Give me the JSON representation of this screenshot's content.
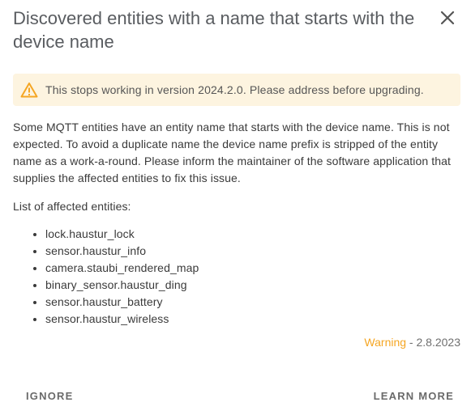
{
  "dialog": {
    "title": "Discovered entities with a name that starts with the device name",
    "close_icon": "close-icon"
  },
  "alert": {
    "icon": "warning-triangle-icon",
    "text": "This stops working in version 2024.2.0. Please address before upgrading.",
    "icon_color": "#f5a623",
    "background": "#fdf4e0"
  },
  "body": {
    "description": "Some MQTT entities have an entity name that starts with the device name. This is not expected. To avoid a duplicate name the device name prefix is stripped of the entity name as a work-a-round. Please inform the maintainer of the software application that supplies the affected entities to fix this issue.",
    "list_heading": "List of affected entities:",
    "entities": [
      "lock.haustur_lock",
      "sensor.haustur_info",
      "camera.staubi_rendered_map",
      "binary_sensor.haustur_ding",
      "sensor.haustur_battery",
      "sensor.haustur_wireless"
    ]
  },
  "meta": {
    "severity": "Warning",
    "separator": " - ",
    "date": "2.8.2023",
    "severity_color": "#f5a623"
  },
  "actions": {
    "ignore_label": "IGNORE",
    "learn_more_label": "LEARN MORE"
  }
}
